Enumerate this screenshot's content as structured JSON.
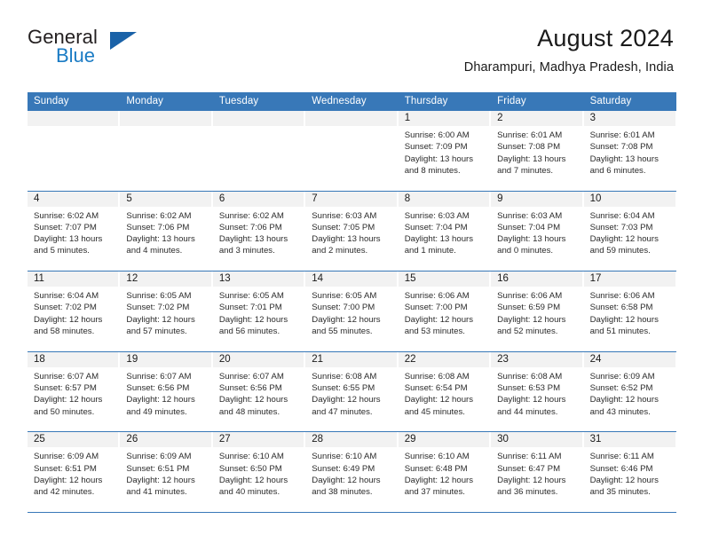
{
  "brand": {
    "name_part1": "General",
    "name_part2": "Blue",
    "triangle_color": "#1a62a8",
    "blue_color": "#1a7bc4"
  },
  "header": {
    "title": "August 2024",
    "location": "Dharampuri, Madhya Pradesh, India",
    "header_bg": "#3878b8",
    "header_text_color": "#ffffff"
  },
  "weekdays": [
    "Sunday",
    "Monday",
    "Tuesday",
    "Wednesday",
    "Thursday",
    "Friday",
    "Saturday"
  ],
  "weeks": [
    [
      {
        "empty": true
      },
      {
        "empty": true
      },
      {
        "empty": true
      },
      {
        "empty": true
      },
      {
        "day": "1",
        "sunrise": "Sunrise: 6:00 AM",
        "sunset": "Sunset: 7:09 PM",
        "daylight": "Daylight: 13 hours and 8 minutes."
      },
      {
        "day": "2",
        "sunrise": "Sunrise: 6:01 AM",
        "sunset": "Sunset: 7:08 PM",
        "daylight": "Daylight: 13 hours and 7 minutes."
      },
      {
        "day": "3",
        "sunrise": "Sunrise: 6:01 AM",
        "sunset": "Sunset: 7:08 PM",
        "daylight": "Daylight: 13 hours and 6 minutes."
      }
    ],
    [
      {
        "day": "4",
        "sunrise": "Sunrise: 6:02 AM",
        "sunset": "Sunset: 7:07 PM",
        "daylight": "Daylight: 13 hours and 5 minutes."
      },
      {
        "day": "5",
        "sunrise": "Sunrise: 6:02 AM",
        "sunset": "Sunset: 7:06 PM",
        "daylight": "Daylight: 13 hours and 4 minutes."
      },
      {
        "day": "6",
        "sunrise": "Sunrise: 6:02 AM",
        "sunset": "Sunset: 7:06 PM",
        "daylight": "Daylight: 13 hours and 3 minutes."
      },
      {
        "day": "7",
        "sunrise": "Sunrise: 6:03 AM",
        "sunset": "Sunset: 7:05 PM",
        "daylight": "Daylight: 13 hours and 2 minutes."
      },
      {
        "day": "8",
        "sunrise": "Sunrise: 6:03 AM",
        "sunset": "Sunset: 7:04 PM",
        "daylight": "Daylight: 13 hours and 1 minute."
      },
      {
        "day": "9",
        "sunrise": "Sunrise: 6:03 AM",
        "sunset": "Sunset: 7:04 PM",
        "daylight": "Daylight: 13 hours and 0 minutes."
      },
      {
        "day": "10",
        "sunrise": "Sunrise: 6:04 AM",
        "sunset": "Sunset: 7:03 PM",
        "daylight": "Daylight: 12 hours and 59 minutes."
      }
    ],
    [
      {
        "day": "11",
        "sunrise": "Sunrise: 6:04 AM",
        "sunset": "Sunset: 7:02 PM",
        "daylight": "Daylight: 12 hours and 58 minutes."
      },
      {
        "day": "12",
        "sunrise": "Sunrise: 6:05 AM",
        "sunset": "Sunset: 7:02 PM",
        "daylight": "Daylight: 12 hours and 57 minutes."
      },
      {
        "day": "13",
        "sunrise": "Sunrise: 6:05 AM",
        "sunset": "Sunset: 7:01 PM",
        "daylight": "Daylight: 12 hours and 56 minutes."
      },
      {
        "day": "14",
        "sunrise": "Sunrise: 6:05 AM",
        "sunset": "Sunset: 7:00 PM",
        "daylight": "Daylight: 12 hours and 55 minutes."
      },
      {
        "day": "15",
        "sunrise": "Sunrise: 6:06 AM",
        "sunset": "Sunset: 7:00 PM",
        "daylight": "Daylight: 12 hours and 53 minutes."
      },
      {
        "day": "16",
        "sunrise": "Sunrise: 6:06 AM",
        "sunset": "Sunset: 6:59 PM",
        "daylight": "Daylight: 12 hours and 52 minutes."
      },
      {
        "day": "17",
        "sunrise": "Sunrise: 6:06 AM",
        "sunset": "Sunset: 6:58 PM",
        "daylight": "Daylight: 12 hours and 51 minutes."
      }
    ],
    [
      {
        "day": "18",
        "sunrise": "Sunrise: 6:07 AM",
        "sunset": "Sunset: 6:57 PM",
        "daylight": "Daylight: 12 hours and 50 minutes."
      },
      {
        "day": "19",
        "sunrise": "Sunrise: 6:07 AM",
        "sunset": "Sunset: 6:56 PM",
        "daylight": "Daylight: 12 hours and 49 minutes."
      },
      {
        "day": "20",
        "sunrise": "Sunrise: 6:07 AM",
        "sunset": "Sunset: 6:56 PM",
        "daylight": "Daylight: 12 hours and 48 minutes."
      },
      {
        "day": "21",
        "sunrise": "Sunrise: 6:08 AM",
        "sunset": "Sunset: 6:55 PM",
        "daylight": "Daylight: 12 hours and 47 minutes."
      },
      {
        "day": "22",
        "sunrise": "Sunrise: 6:08 AM",
        "sunset": "Sunset: 6:54 PM",
        "daylight": "Daylight: 12 hours and 45 minutes."
      },
      {
        "day": "23",
        "sunrise": "Sunrise: 6:08 AM",
        "sunset": "Sunset: 6:53 PM",
        "daylight": "Daylight: 12 hours and 44 minutes."
      },
      {
        "day": "24",
        "sunrise": "Sunrise: 6:09 AM",
        "sunset": "Sunset: 6:52 PM",
        "daylight": "Daylight: 12 hours and 43 minutes."
      }
    ],
    [
      {
        "day": "25",
        "sunrise": "Sunrise: 6:09 AM",
        "sunset": "Sunset: 6:51 PM",
        "daylight": "Daylight: 12 hours and 42 minutes."
      },
      {
        "day": "26",
        "sunrise": "Sunrise: 6:09 AM",
        "sunset": "Sunset: 6:51 PM",
        "daylight": "Daylight: 12 hours and 41 minutes."
      },
      {
        "day": "27",
        "sunrise": "Sunrise: 6:10 AM",
        "sunset": "Sunset: 6:50 PM",
        "daylight": "Daylight: 12 hours and 40 minutes."
      },
      {
        "day": "28",
        "sunrise": "Sunrise: 6:10 AM",
        "sunset": "Sunset: 6:49 PM",
        "daylight": "Daylight: 12 hours and 38 minutes."
      },
      {
        "day": "29",
        "sunrise": "Sunrise: 6:10 AM",
        "sunset": "Sunset: 6:48 PM",
        "daylight": "Daylight: 12 hours and 37 minutes."
      },
      {
        "day": "30",
        "sunrise": "Sunrise: 6:11 AM",
        "sunset": "Sunset: 6:47 PM",
        "daylight": "Daylight: 12 hours and 36 minutes."
      },
      {
        "day": "31",
        "sunrise": "Sunrise: 6:11 AM",
        "sunset": "Sunset: 6:46 PM",
        "daylight": "Daylight: 12 hours and 35 minutes."
      }
    ]
  ]
}
